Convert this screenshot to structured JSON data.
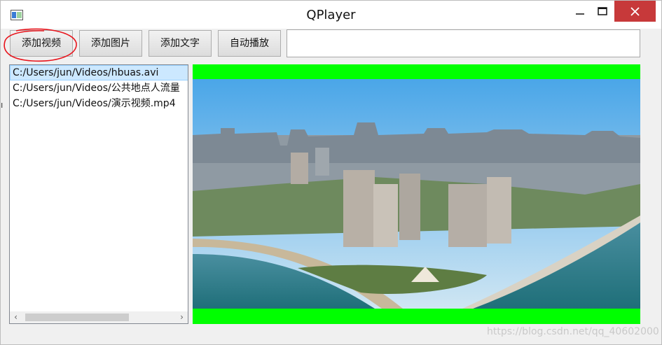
{
  "window": {
    "title": "QPlayer"
  },
  "toolbar": {
    "add_video": "添加视频",
    "add_image": "添加图片",
    "add_text": "添加文字",
    "autoplay": "自动播放",
    "text_value": ""
  },
  "playlist": {
    "items": [
      "C:/Users/jun/Videos/hbuas.avi",
      "C:/Users/jun/Videos/公共地点人流量",
      "C:/Users/jun/Videos/演示视频.mp4"
    ],
    "selected_index": 0,
    "scroll_left": "‹",
    "scroll_right": "›"
  },
  "video": {
    "letterbox_color": "#00ff00"
  },
  "watermark": "https://blog.csdn.net/qq_40602000",
  "colors": {
    "close_button": "#c7393a",
    "selection": "#cce8ff",
    "annotation": "#e8141c"
  }
}
